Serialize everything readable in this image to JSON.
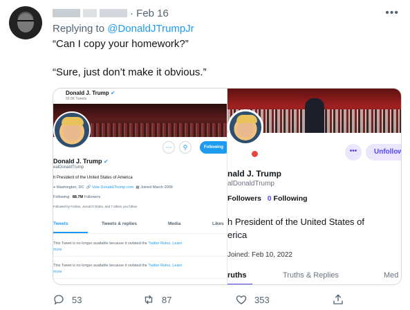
{
  "tweet": {
    "date": "· Feb 16",
    "replying_prefix": "Replying to ",
    "replying_handle": "@DonaldJTrumpJr",
    "line1": "“Can I copy your homework?”",
    "line2": "“Sure, just don’t make it obvious.”",
    "more_icon": "more-horizontal-icon"
  },
  "left_shot": {
    "header_name": "Donald J. Trump",
    "header_count": "59.5K Tweets",
    "follow_label": "Following",
    "display_name": "Donald J. Trump",
    "handle": "ealDonaldTrump",
    "bio": "h President of the United States of America",
    "location": "Washington, DC",
    "link": "Vote.DonaldJTrump.com",
    "joined": "Joined March 2009",
    "following_label": "Following",
    "followers_count": "88.7M",
    "followers_label": "Followers",
    "followed_by": "Followed by Forbes, Jornal O Globo, and 7 others you follow",
    "tabs": [
      "Tweets",
      "Tweets & replies",
      "Media",
      "Likes"
    ],
    "withheld_msg": "This Tweet is no longer available because it violated the",
    "rules_link": "Twitter Rules.",
    "learn_more": "Learn",
    "more": "more"
  },
  "right_shot": {
    "more_label": "•••",
    "unfollow_label": "Unfollow",
    "display_name": "nald J. Trump",
    "handle": "alDonaldTrump",
    "followers_label": "Followers",
    "following_count": "0",
    "following_label": "Following",
    "bio_line1": "h President of the United States of",
    "bio_line2": "erica",
    "joined": "Joined: Feb 10, 2022",
    "tabs": [
      "ruths",
      "Truths & Replies",
      "Med"
    ]
  },
  "actions": {
    "replies": "53",
    "retweets": "87",
    "likes": "353"
  },
  "colors": {
    "twitter_blue": "#1d9bf0",
    "truth_purple": "#5448ee",
    "muted": "#536471"
  }
}
